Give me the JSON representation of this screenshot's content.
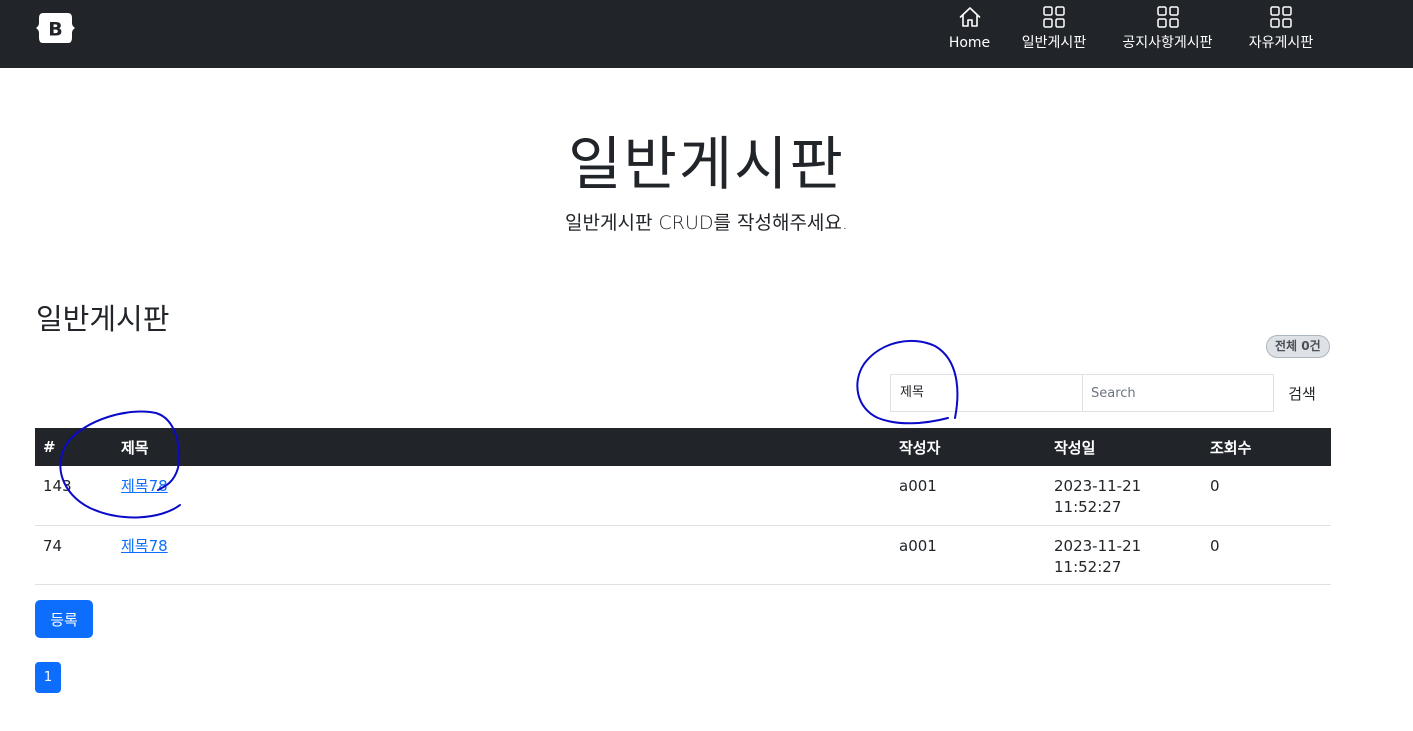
{
  "brand": {
    "logo_letter": "B"
  },
  "nav": {
    "items": [
      {
        "label": "Home",
        "icon": "house-icon"
      },
      {
        "label": "일반게시판",
        "icon": "grid-icon"
      },
      {
        "label": "공지사항게시판",
        "icon": "grid-icon"
      },
      {
        "label": "자유게시판",
        "icon": "grid-icon"
      }
    ]
  },
  "hero": {
    "title": "일반게시판",
    "subtitle": "일반게시판 CRUD를 작성해주세요."
  },
  "board": {
    "title": "일반게시판",
    "count_badge": "전체 0건",
    "search": {
      "type_value": "제목",
      "placeholder": "Search",
      "button_label": "검색"
    },
    "columns": [
      "#",
      "제목",
      "작성자",
      "작성일",
      "조회수"
    ],
    "rows": [
      {
        "num": "143",
        "title": "제목78",
        "writer": "a001",
        "date": "2023-11-21",
        "time": "11:52:27",
        "views": "0"
      },
      {
        "num": "74",
        "title": "제목78",
        "writer": "a001",
        "date": "2023-11-21",
        "time": "11:52:27",
        "views": "0"
      }
    ],
    "register_label": "등록",
    "pagination": [
      "1"
    ]
  },
  "colors": {
    "navbar": "#212529",
    "primary": "#0d6efd",
    "annotation_ink": "#0a0ac8"
  }
}
